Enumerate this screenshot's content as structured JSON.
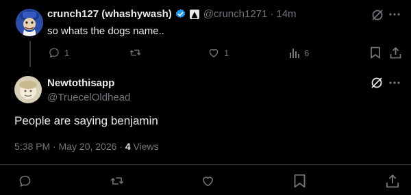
{
  "reply": {
    "display_name": "crunch127 (whashywash)",
    "handle": "@crunch1271",
    "separator": "·",
    "time": "14m",
    "text": "so whats the dogs name..",
    "counts": {
      "replies": "1",
      "likes": "1",
      "views": "6"
    }
  },
  "main": {
    "display_name": "Newtothisapp",
    "handle": "@TruecelOldhead",
    "text": "People are saying benjamin",
    "timestamp": "5:38 PM · May 20, 2026 · ",
    "views_count": "4",
    "views_label": " Views"
  },
  "colors": {
    "background": "#000000",
    "text": "#e7e9ea",
    "muted": "#71767b",
    "verified": "#1d9bf0",
    "divider": "#2f3336"
  },
  "icons": [
    "verified-badge-icon",
    "affiliate-badge-icon",
    "grok-icon",
    "more-icon",
    "reply-icon",
    "repost-icon",
    "like-icon",
    "views-icon",
    "bookmark-icon",
    "share-icon"
  ]
}
